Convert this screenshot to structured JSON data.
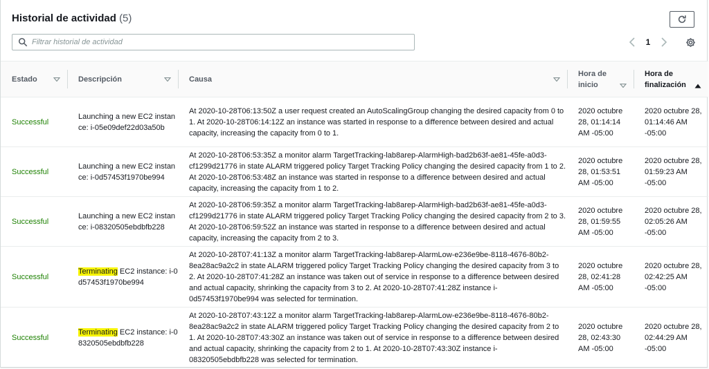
{
  "header": {
    "title": "Historial de actividad",
    "count": "(5)"
  },
  "search": {
    "placeholder": "Filtrar historial de actividad"
  },
  "pagination": {
    "current_page": "1"
  },
  "columns": {
    "status": "Estado",
    "description": "Descripción",
    "cause": "Causa",
    "start_time": "Hora de inicio",
    "end_time": "Hora de finalización"
  },
  "rows": [
    {
      "status": "Successful",
      "description_action": "Launching",
      "description_rest": " a new EC2 instance: i-05e09def22d03a50b",
      "cause": "At 2020-10-28T06:13:50Z a user request created an AutoScalingGroup changing the desired capacity from 0 to 1. At 2020-10-28T06:14:12Z an instance was started in response to a difference between desired and actual capacity, increasing the capacity from 0 to 1.",
      "start_time": "2020 octubre 28, 01:14:14 AM -05:00",
      "end_time": "2020 octubre 28, 01:14:46 AM -05:00",
      "highlighted": false
    },
    {
      "status": "Successful",
      "description_action": "Launching",
      "description_rest": " a new EC2 instance: i-0d57453f1970be994",
      "cause": "At 2020-10-28T06:53:35Z a monitor alarm TargetTracking-lab8arep-AlarmHigh-bad2b63f-ae81-45fe-a0d3-cf1299d21776 in state ALARM triggered policy Target Tracking Policy changing the desired capacity from 1 to 2. At 2020-10-28T06:53:48Z an instance was started in response to a difference between desired and actual capacity, increasing the capacity from 1 to 2.",
      "start_time": "2020 octubre 28, 01:53:51 AM -05:00",
      "end_time": "2020 octubre 28, 01:59:23 AM -05:00",
      "highlighted": false
    },
    {
      "status": "Successful",
      "description_action": "Launching",
      "description_rest": " a new EC2 instance: i-08320505ebdbfb228",
      "cause": "At 2020-10-28T06:59:35Z a monitor alarm TargetTracking-lab8arep-AlarmHigh-bad2b63f-ae81-45fe-a0d3-cf1299d21776 in state ALARM triggered policy Target Tracking Policy changing the desired capacity from 2 to 3. At 2020-10-28T06:59:52Z an instance was started in response to a difference between desired and actual capacity, increasing the capacity from 2 to 3.",
      "start_time": "2020 octubre 28, 01:59:55 AM -05:00",
      "end_time": "2020 octubre 28, 02:05:26 AM -05:00",
      "highlighted": false
    },
    {
      "status": "Successful",
      "description_action": "Terminating",
      "description_rest": " EC2 instance: i-0d57453f1970be994",
      "cause": "At 2020-10-28T07:41:13Z a monitor alarm TargetTracking-lab8arep-AlarmLow-e236e9be-8118-4676-80b2-8ea28ac9a2c2 in state ALARM triggered policy Target Tracking Policy changing the desired capacity from 3 to 2. At 2020-10-28T07:41:28Z an instance was taken out of service in response to a difference between desired and actual capacity, shrinking the capacity from 3 to 2. At 2020-10-28T07:41:28Z instance i-0d57453f1970be994 was selected for termination.",
      "start_time": "2020 octubre 28, 02:41:28 AM -05:00",
      "end_time": "2020 octubre 28, 02:42:25 AM -05:00",
      "highlighted": true
    },
    {
      "status": "Successful",
      "description_action": "Terminating",
      "description_rest": " EC2 instance: i-08320505ebdbfb228",
      "cause": "At 2020-10-28T07:43:12Z a monitor alarm TargetTracking-lab8arep-AlarmLow-e236e9be-8118-4676-80b2-8ea28ac9a2c2 in state ALARM triggered policy Target Tracking Policy changing the desired capacity from 2 to 1. At 2020-10-28T07:43:30Z an instance was taken out of service in response to a difference between desired and actual capacity, shrinking the capacity from 2 to 1. At 2020-10-28T07:43:30Z instance i-08320505ebdbfb228 was selected for termination.",
      "start_time": "2020 octubre 28, 02:43:30 AM -05:00",
      "end_time": "2020 octubre 28, 02:44:29 AM -05:00",
      "highlighted": true
    }
  ],
  "colors": {
    "status_success": "#1d8102",
    "highlight": "#f7f400",
    "border": "#eaeded"
  },
  "icons": {
    "refresh": "refresh-icon",
    "search": "search-icon",
    "prev": "chevron-left-icon",
    "next": "chevron-right-icon",
    "settings": "gear-icon",
    "sort": "caret-down-icon",
    "sorted": "caret-up-icon"
  }
}
